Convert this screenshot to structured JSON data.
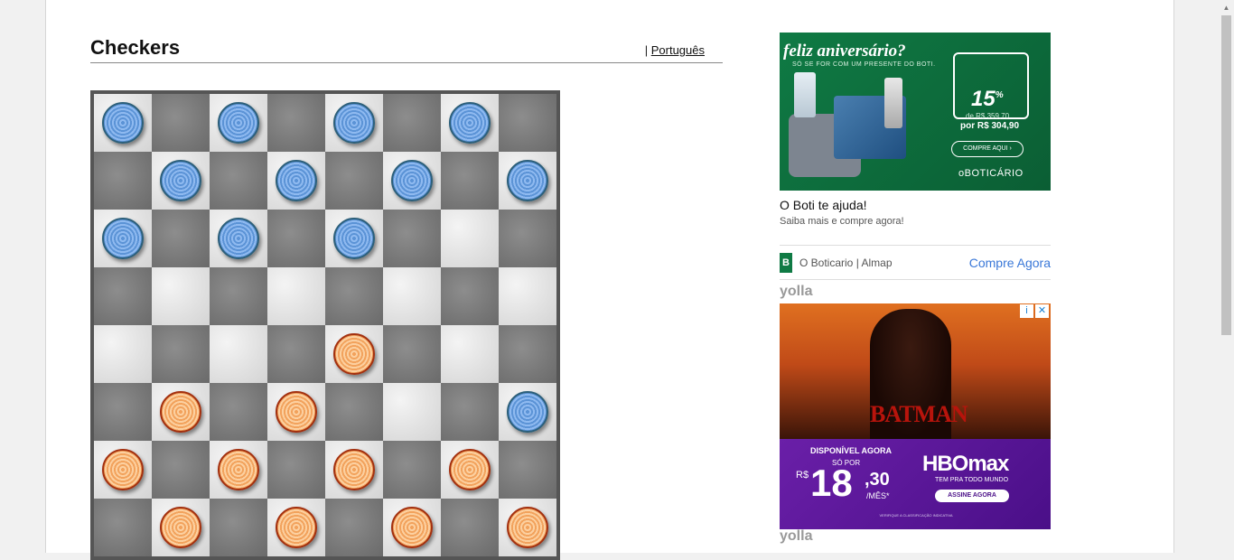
{
  "header": {
    "title": "Checkers",
    "separator": "|",
    "language_link": "Português"
  },
  "board": {
    "rows": [
      [
        "blue",
        "",
        "blue",
        "",
        "blue",
        "",
        "blue",
        ""
      ],
      [
        "",
        "blue",
        "",
        "blue",
        "",
        "blue",
        "",
        "blue"
      ],
      [
        "blue",
        "",
        "blue",
        "",
        "blue",
        "",
        "",
        ""
      ],
      [
        "",
        "",
        "",
        "",
        "",
        "",
        "",
        ""
      ],
      [
        "",
        "",
        "",
        "",
        "orange",
        "",
        "",
        ""
      ],
      [
        "",
        "orange",
        "",
        "orange",
        "",
        "",
        "",
        "blue"
      ],
      [
        "orange",
        "",
        "orange",
        "",
        "orange",
        "",
        "orange",
        ""
      ],
      [
        "",
        "orange",
        "",
        "orange",
        "",
        "orange",
        "",
        "orange"
      ]
    ],
    "colors": {
      "blue": "#5b93d6",
      "orange": "#f2a25c",
      "light_square": "#e0e0e0",
      "dark_square": "#777777"
    }
  },
  "ad1": {
    "headline": "feliz aniversário?",
    "subline": "SÓ SE FOR COM UM PRESENTE DO BOTI.",
    "discount": "15",
    "discount_unit": "%",
    "old_price": "de R$ 359,70",
    "new_price": "por R$ 304,90",
    "cta": "COMPRE AQUI ›",
    "brand": "oBOTICÁRIO",
    "title": "O Boti te ajuda!",
    "description": "Saiba mais e compre agora!",
    "advertiser_logo": "B",
    "advertiser": "O Boticario | Almap",
    "link": "Compre Agora"
  },
  "yolla": {
    "label": "yolla"
  },
  "ad2": {
    "info_icon": "i",
    "close_icon": "✕",
    "movie": "BATMAN",
    "available": "DISPONÍVEL AGORA",
    "so_por": "SÓ POR",
    "currency": "R$",
    "price_int": "18",
    "price_cents": ",30",
    "per_month": "/MÊS*",
    "brand": "HBOmax",
    "tagline": "TEM PRA TODO MUNDO",
    "cta": "ASSINE AGORA",
    "fine_print": "VERIFIQUE A CLASSIFICAÇÃO INDICATIVA"
  },
  "scrollbar": {
    "up_arrow": "▲"
  }
}
